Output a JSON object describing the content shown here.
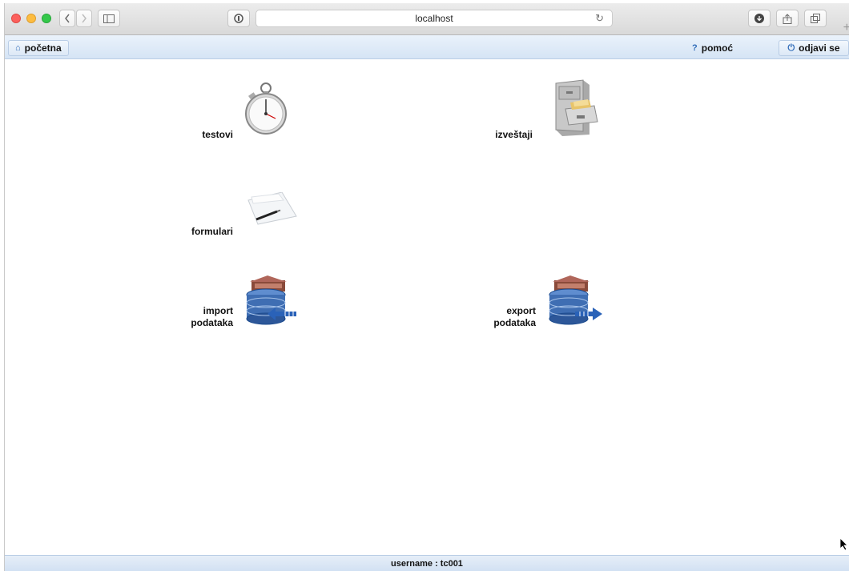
{
  "browser": {
    "url": "localhost"
  },
  "nav": {
    "home_label": "početna",
    "help_label": "pomoć",
    "logout_label": "odjavi se"
  },
  "menu": {
    "tests": "testovi",
    "reports": "izveštaji",
    "forms": "formulari",
    "import_line1": "import",
    "import_line2": "podataka",
    "export_line1": "export",
    "export_line2": "podataka"
  },
  "footer": {
    "username": "username : tc001"
  },
  "icons": {
    "tests": "stopwatch-icon",
    "reports": "file-cabinet-icon",
    "forms": "pen-paper-icon",
    "import": "database-import-icon",
    "export": "database-export-icon"
  }
}
